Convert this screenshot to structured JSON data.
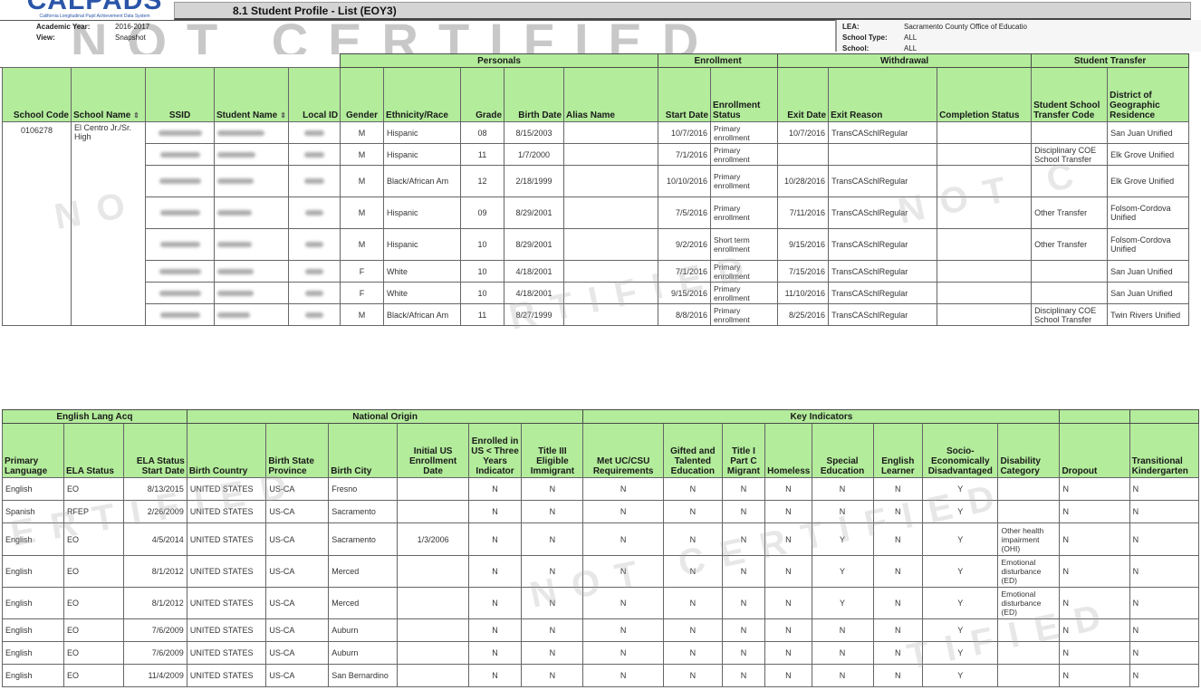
{
  "header": {
    "logo_text": "CALPADS",
    "logo_subtitle": "California Longitudinal Pupil Achievement Data System",
    "report_title": "8.1  Student Profile - List (EOY3)",
    "watermark": "NOT CERTIFIED",
    "academic_year_label": "Academic Year:",
    "academic_year": "2016-2017",
    "view_label": "View:",
    "view": "Snapshot",
    "lea_label": "LEA:",
    "lea": "Sacramento County Office of Educatio",
    "school_type_label": "School Type:",
    "school_type": "ALL",
    "school_label": "School:",
    "school": "ALL"
  },
  "table1": {
    "groups": {
      "personals": "Personals",
      "enrollment": "Enrollment",
      "withdrawal": "Withdrawal",
      "student_transfer": "Student Transfer"
    },
    "columns": {
      "school_code": "School Code",
      "school_name": "School Name",
      "ssid": "SSID",
      "student_name": "Student Name",
      "local_id": "Local ID",
      "gender": "Gender",
      "ethnicity": "Ethnicity/Race",
      "grade": "Grade",
      "birth_date": "Birth Date",
      "alias_name": "Alias Name",
      "start_date": "Start Date",
      "enrollment_status": "Enrollment Status",
      "exit_date": "Exit Date",
      "exit_reason": "Exit Reason",
      "completion_status": "Completion Status",
      "transfer_code": "Student School Transfer Code",
      "district_residence": "District of Geographic Residence"
    },
    "sort_icon": "sort-arrows-icon",
    "school_code": "0106278",
    "school_name": "El Centro Jr./Sr. High",
    "rows": [
      {
        "gender": "M",
        "ethnicity": "Hispanic",
        "grade": "08",
        "birth_date": "8/15/2003",
        "alias": "",
        "start_date": "10/7/2016",
        "enrollment_status": "Primary enrollment",
        "exit_date": "10/7/2016",
        "exit_reason": "TransCASchlRegular",
        "completion": "",
        "transfer_code": "",
        "district": "San Juan Unified"
      },
      {
        "gender": "M",
        "ethnicity": "Hispanic",
        "grade": "11",
        "birth_date": "1/7/2000",
        "alias": "",
        "start_date": "7/1/2016",
        "enrollment_status": "Primary enrollment",
        "exit_date": "",
        "exit_reason": "",
        "completion": "",
        "transfer_code": "Disciplinary COE School Transfer",
        "district": "Elk Grove Unified"
      },
      {
        "gender": "M",
        "ethnicity": "Black/African Am",
        "grade": "12",
        "birth_date": "2/18/1999",
        "alias": "",
        "start_date": "10/10/2016",
        "enrollment_status": "Primary enrollment",
        "exit_date": "10/28/2016",
        "exit_reason": "TransCASchlRegular",
        "completion": "",
        "transfer_code": "",
        "district": "Elk Grove Unified"
      },
      {
        "gender": "M",
        "ethnicity": "Hispanic",
        "grade": "09",
        "birth_date": "8/29/2001",
        "alias": "",
        "start_date": "7/5/2016",
        "enrollment_status": "Primary enrollment",
        "exit_date": "7/11/2016",
        "exit_reason": "TransCASchlRegular",
        "completion": "",
        "transfer_code": "Other Transfer",
        "district": "Folsom-Cordova Unified"
      },
      {
        "gender": "M",
        "ethnicity": "Hispanic",
        "grade": "10",
        "birth_date": "8/29/2001",
        "alias": "",
        "start_date": "9/2/2016",
        "enrollment_status": "Short term enrollment",
        "exit_date": "9/15/2016",
        "exit_reason": "TransCASchlRegular",
        "completion": "",
        "transfer_code": "Other Transfer",
        "district": "Folsom-Cordova Unified"
      },
      {
        "gender": "F",
        "ethnicity": "White",
        "grade": "10",
        "birth_date": "4/18/2001",
        "alias": "",
        "start_date": "7/1/2016",
        "enrollment_status": "Primary enrollment",
        "exit_date": "7/15/2016",
        "exit_reason": "TransCASchlRegular",
        "completion": "",
        "transfer_code": "",
        "district": "San Juan Unified"
      },
      {
        "gender": "F",
        "ethnicity": "White",
        "grade": "10",
        "birth_date": "4/18/2001",
        "alias": "",
        "start_date": "9/15/2016",
        "enrollment_status": "Primary enrollment",
        "exit_date": "11/10/2016",
        "exit_reason": "TransCASchlRegular",
        "completion": "",
        "transfer_code": "",
        "district": "San Juan Unified"
      },
      {
        "gender": "M",
        "ethnicity": "Black/African Am",
        "grade": "11",
        "birth_date": "8/27/1999",
        "alias": "",
        "start_date": "8/8/2016",
        "enrollment_status": "Primary enrollment",
        "exit_date": "8/25/2016",
        "exit_reason": "TransCASchlRegular",
        "completion": "",
        "transfer_code": "Disciplinary COE School Transfer",
        "district": "Twin Rivers Unified"
      }
    ]
  },
  "table2": {
    "groups": {
      "english_lang_acq": "English Lang Acq",
      "national_origin": "National Origin",
      "key_indicators": "Key Indicators"
    },
    "columns": {
      "primary_language": "Primary Language",
      "ela_status": "ELA Status",
      "ela_start": "ELA Status Start Date",
      "birth_country": "Birth Country",
      "birth_state": "Birth State Province",
      "birth_city": "Birth City",
      "initial_us": "Initial US Enrollment Date",
      "enrolled_lt3": "Enrolled in US < Three Years Indicator",
      "title3": "Title III Eligible Immigrant",
      "uccsu": "Met UC/CSU Requirements",
      "gate": "Gifted and Talented Education",
      "title1c": "Title I Part C Migrant",
      "homeless": "Homeless",
      "sped": "Special Education",
      "el": "English Learner",
      "sed": "Socio-Economically Disadvantaged",
      "disability": "Disability Category",
      "dropout": "Dropout",
      "tk": "Transitional Kindergarten"
    },
    "rows": [
      {
        "lang": "English",
        "ela": "EO",
        "ela_start": "8/13/2015",
        "country": "UNITED STATES",
        "state": "US-CA",
        "city": "Fresno",
        "initial_us": "",
        "lt3": "N",
        "t3": "N",
        "uccsu": "N",
        "gate": "N",
        "t1c": "N",
        "homeless": "N",
        "sped": "N",
        "el": "N",
        "sed": "Y",
        "disability": "",
        "dropout": "N",
        "tk": "N"
      },
      {
        "lang": "Spanish",
        "ela": "RFEP",
        "ela_start": "2/26/2009",
        "country": "UNITED STATES",
        "state": "US-CA",
        "city": "Sacramento",
        "initial_us": "",
        "lt3": "N",
        "t3": "N",
        "uccsu": "N",
        "gate": "N",
        "t1c": "N",
        "homeless": "N",
        "sped": "N",
        "el": "N",
        "sed": "Y",
        "disability": "",
        "dropout": "N",
        "tk": "N"
      },
      {
        "lang": "English",
        "ela": "EO",
        "ela_start": "4/5/2014",
        "country": "UNITED STATES",
        "state": "US-CA",
        "city": "Sacramento",
        "initial_us": "1/3/2006",
        "lt3": "N",
        "t3": "N",
        "uccsu": "N",
        "gate": "N",
        "t1c": "N",
        "homeless": "N",
        "sped": "Y",
        "el": "N",
        "sed": "Y",
        "disability": "Other health impairment (OHI)",
        "dropout": "N",
        "tk": "N"
      },
      {
        "lang": "English",
        "ela": "EO",
        "ela_start": "8/1/2012",
        "country": "UNITED STATES",
        "state": "US-CA",
        "city": "Merced",
        "initial_us": "",
        "lt3": "N",
        "t3": "N",
        "uccsu": "N",
        "gate": "N",
        "t1c": "N",
        "homeless": "N",
        "sped": "Y",
        "el": "N",
        "sed": "Y",
        "disability": "Emotional disturbance (ED)",
        "dropout": "N",
        "tk": "N"
      },
      {
        "lang": "English",
        "ela": "EO",
        "ela_start": "8/1/2012",
        "country": "UNITED STATES",
        "state": "US-CA",
        "city": "Merced",
        "initial_us": "",
        "lt3": "N",
        "t3": "N",
        "uccsu": "N",
        "gate": "N",
        "t1c": "N",
        "homeless": "N",
        "sped": "Y",
        "el": "N",
        "sed": "Y",
        "disability": "Emotional disturbance (ED)",
        "dropout": "N",
        "tk": "N"
      },
      {
        "lang": "English",
        "ela": "EO",
        "ela_start": "7/6/2009",
        "country": "UNITED STATES",
        "state": "US-CA",
        "city": "Auburn",
        "initial_us": "",
        "lt3": "N",
        "t3": "N",
        "uccsu": "N",
        "gate": "N",
        "t1c": "N",
        "homeless": "N",
        "sped": "N",
        "el": "N",
        "sed": "Y",
        "disability": "",
        "dropout": "N",
        "tk": "N"
      },
      {
        "lang": "English",
        "ela": "EO",
        "ela_start": "7/6/2009",
        "country": "UNITED STATES",
        "state": "US-CA",
        "city": "Auburn",
        "initial_us": "",
        "lt3": "N",
        "t3": "N",
        "uccsu": "N",
        "gate": "N",
        "t1c": "N",
        "homeless": "N",
        "sped": "N",
        "el": "N",
        "sed": "Y",
        "disability": "",
        "dropout": "N",
        "tk": "N"
      },
      {
        "lang": "English",
        "ela": "EO",
        "ela_start": "11/4/2009",
        "country": "UNITED STATES",
        "state": "US-CA",
        "city": "San Bernardino",
        "initial_us": "",
        "lt3": "N",
        "t3": "N",
        "uccsu": "N",
        "gate": "N",
        "t1c": "N",
        "homeless": "N",
        "sped": "N",
        "el": "N",
        "sed": "Y",
        "disability": "",
        "dropout": "N",
        "tk": "N"
      }
    ]
  }
}
